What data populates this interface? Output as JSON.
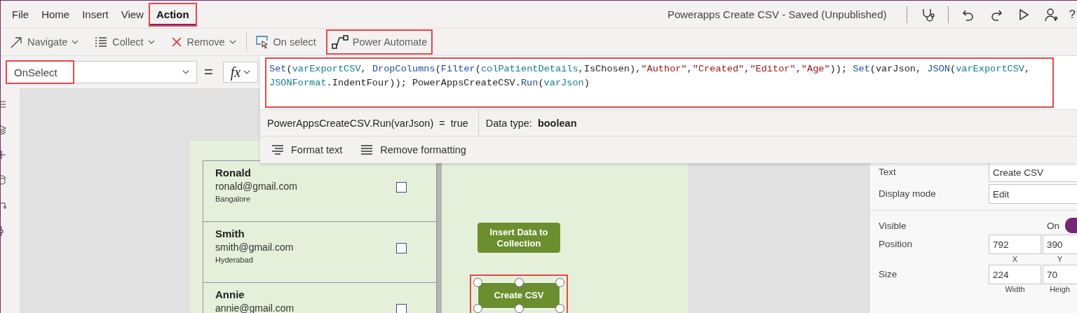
{
  "menu": {
    "tabs": [
      {
        "label": "File",
        "selected": false,
        "highlighted": false
      },
      {
        "label": "Home",
        "selected": false,
        "highlighted": false
      },
      {
        "label": "Insert",
        "selected": false,
        "highlighted": false
      },
      {
        "label": "View",
        "selected": false,
        "highlighted": false
      },
      {
        "label": "Action",
        "selected": true,
        "highlighted": true
      }
    ],
    "title": "Powerapps Create CSV - Saved (Unpublished)",
    "help": "?"
  },
  "toolbar": {
    "items": [
      {
        "kind": "button",
        "label": "Navigate",
        "dropdown": true,
        "highlighted": false
      },
      {
        "kind": "button",
        "label": "Collect",
        "dropdown": true,
        "highlighted": false
      },
      {
        "kind": "button",
        "label": "Remove",
        "dropdown": true,
        "highlighted": false
      },
      {
        "kind": "separator"
      },
      {
        "kind": "button",
        "label": "On select",
        "dropdown": false,
        "highlighted": false
      },
      {
        "kind": "button",
        "label": "Power Automate",
        "dropdown": false,
        "highlighted": true
      }
    ]
  },
  "formula_bar": {
    "property": "OnSelect",
    "property_highlighted": true,
    "equals": "=",
    "fx": "fx",
    "editor_highlighted": true,
    "code_lines": [
      [
        {
          "text": "Set",
          "kind": "fn"
        },
        {
          "text": "(",
          "kind": "plain"
        },
        {
          "text": "varExportCSV",
          "kind": "var"
        },
        {
          "text": ", ",
          "kind": "plain"
        },
        {
          "text": "DropColumns",
          "kind": "fn"
        },
        {
          "text": "(",
          "kind": "plain"
        },
        {
          "text": "Filter",
          "kind": "fn"
        },
        {
          "text": "(",
          "kind": "plain"
        },
        {
          "text": "colPatientDetails",
          "kind": "var"
        },
        {
          "text": ",IsChosen),",
          "kind": "plain"
        },
        {
          "text": "\"Author\"",
          "kind": "str"
        },
        {
          "text": ",",
          "kind": "plain"
        },
        {
          "text": "\"Created\"",
          "kind": "str"
        },
        {
          "text": ",",
          "kind": "plain"
        },
        {
          "text": "\"Editor\"",
          "kind": "str"
        },
        {
          "text": ",",
          "kind": "plain"
        },
        {
          "text": "\"Age\"",
          "kind": "str"
        },
        {
          "text": ")); ",
          "kind": "plain"
        },
        {
          "text": "Set",
          "kind": "fn"
        },
        {
          "text": "(varJson, ",
          "kind": "plain"
        },
        {
          "text": "JSON",
          "kind": "fn"
        },
        {
          "text": "(",
          "kind": "plain"
        },
        {
          "text": "varExportCSV",
          "kind": "var"
        },
        {
          "text": ",",
          "kind": "plain"
        }
      ],
      [
        {
          "text": "JSONFormat",
          "kind": "var"
        },
        {
          "text": ".IndentFour)); PowerAppsCreateCSV.",
          "kind": "plain"
        },
        {
          "text": "Run",
          "kind": "fn"
        },
        {
          "text": "(",
          "kind": "plain"
        },
        {
          "text": "varJson",
          "kind": "var"
        },
        {
          "text": ")",
          "kind": "plain"
        }
      ]
    ],
    "result": "PowerAppsCreateCSV.Run(varJson)  =  true",
    "data_type": "Data type: **boolean**",
    "format_actions": [
      {
        "label": "Format text"
      },
      {
        "label": "Remove formatting"
      }
    ]
  },
  "gallery": {
    "rows": [
      {
        "name": "Ronald",
        "email": "ronald@gmail.com",
        "city": "Bangalore",
        "checked": false
      },
      {
        "name": "Smith",
        "email": "smith@gmail.com",
        "city": "Hyderabad",
        "checked": false
      },
      {
        "name": "Annie",
        "email": "annie@gmail.com",
        "checked": false
      }
    ]
  },
  "screen_buttons": [
    {
      "label": "Insert Data to Collection",
      "selected": false,
      "highlighted": false
    },
    {
      "label": "Create CSV",
      "selected": true,
      "highlighted": true
    }
  ],
  "properties": {
    "sections": [
      [
        {
          "kind": "text",
          "label": "Text",
          "value": "Create CSV"
        },
        {
          "kind": "text",
          "label": "Display mode",
          "value": "Edit"
        }
      ],
      [
        {
          "kind": "toggle",
          "label": "Visible",
          "value": "On",
          "on": true
        },
        {
          "kind": "pair",
          "label": "Position",
          "fields": [
            {
              "value": "792",
              "caption": "X"
            },
            {
              "value": "390",
              "caption": "Y"
            }
          ]
        },
        {
          "kind": "pair",
          "label": "Size",
          "fields": [
            {
              "value": "224",
              "caption": "Width"
            },
            {
              "value": "70",
              "caption": "Heigh"
            }
          ]
        }
      ]
    ]
  }
}
